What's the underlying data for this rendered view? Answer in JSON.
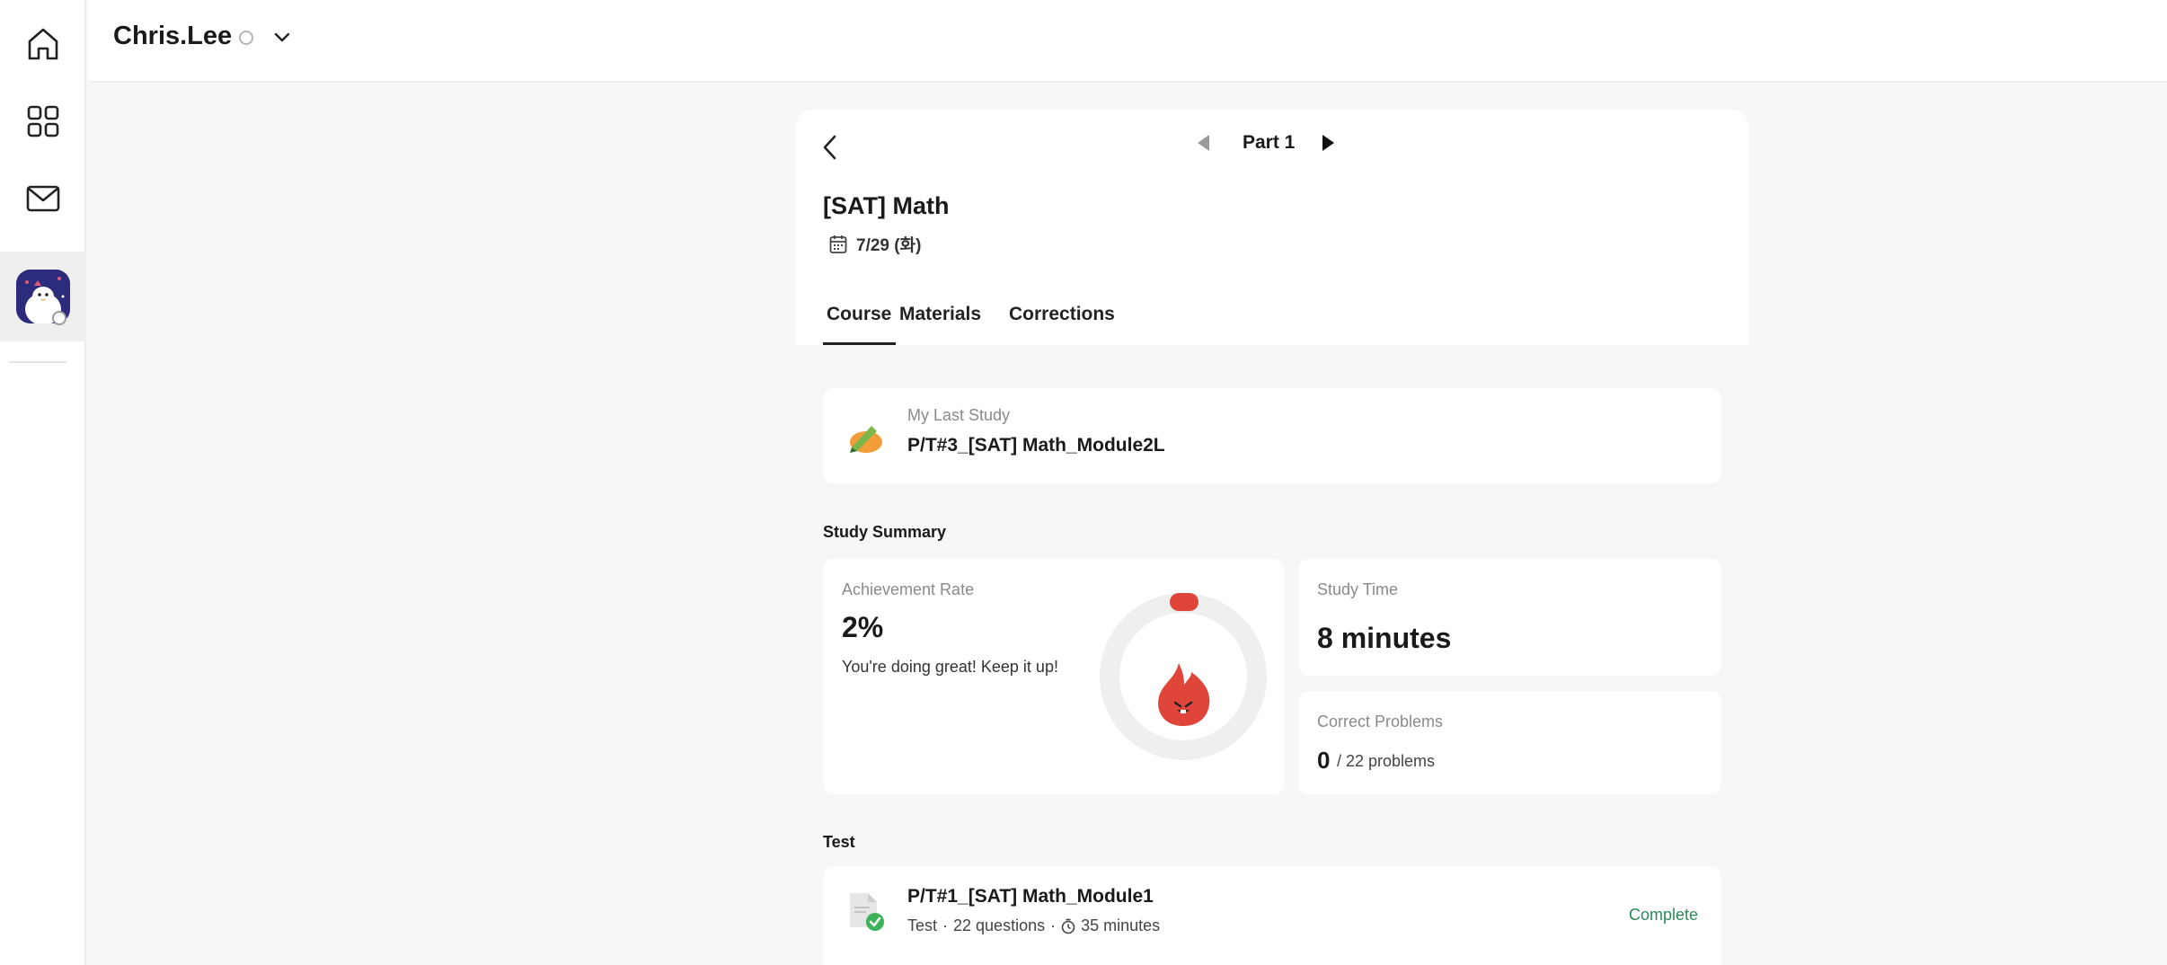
{
  "user": {
    "name": "Chris.Lee"
  },
  "nav": {
    "items": [
      {
        "icon": "home-icon"
      },
      {
        "icon": "apps-grid-icon"
      },
      {
        "icon": "mail-icon"
      },
      {
        "icon": "avatar"
      }
    ]
  },
  "header": {
    "part_label": "Part 1",
    "course_title": "[SAT] Math",
    "date": "7/29 (화)",
    "tabs": [
      {
        "label": "Course",
        "active": true
      },
      {
        "label": "Materials",
        "active": false
      },
      {
        "label": "Corrections",
        "active": false
      }
    ]
  },
  "last_study": {
    "label": "My Last Study",
    "value": "P/T#3_[SAT] Math_Module2L"
  },
  "study_summary": {
    "title": "Study Summary",
    "achievement": {
      "label": "Achievement Rate",
      "value": "2%",
      "fraction": 0.02,
      "message": "You're doing great! Keep it up!"
    },
    "study_time": {
      "label": "Study Time",
      "value": "8 minutes"
    },
    "correct": {
      "label": "Correct Problems",
      "count": "0",
      "total": "/ 22 problems"
    }
  },
  "test_section": {
    "title": "Test",
    "items": [
      {
        "name": "P/T#1_[SAT] Math_Module1",
        "type": "Test",
        "questions": "22 questions",
        "duration": "35 minutes",
        "status": "Complete"
      }
    ]
  },
  "colors": {
    "accent_red": "#e0453a",
    "status_green": "#2a8a5a",
    "avatar_bg": "#2d2b7c"
  }
}
